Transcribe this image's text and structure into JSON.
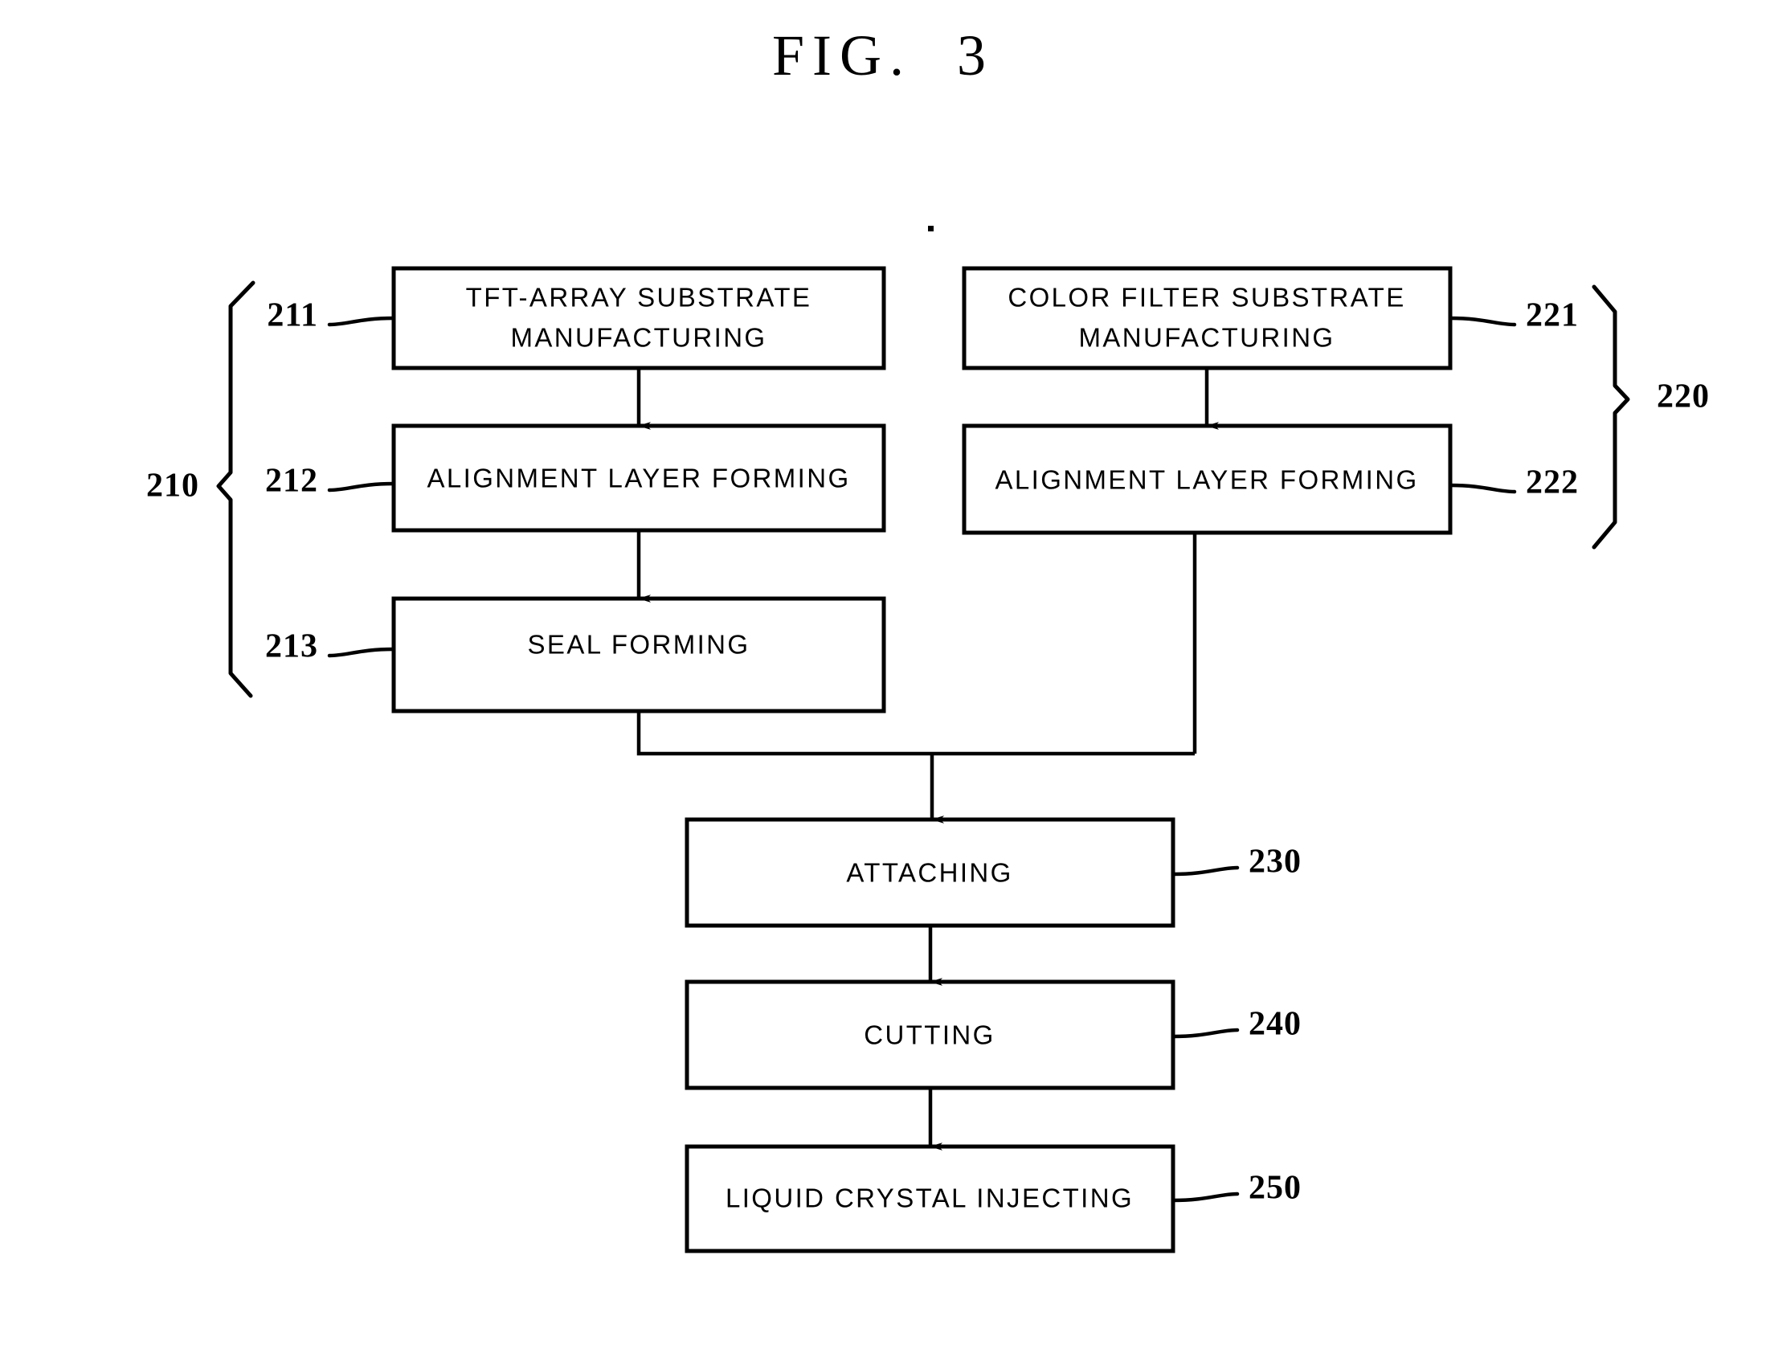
{
  "figure": {
    "title": "FIG.  3",
    "domain_note": "patent flow diagram",
    "stroke_color": "#000000",
    "background_color": "#ffffff"
  },
  "boxes": [
    {
      "id": "211",
      "label_line1": "TFT-ARRAY SUBSTRATE",
      "label_line2": "MANUFACTURING"
    },
    {
      "id": "212",
      "label_line1": "ALIGNMENT LAYER FORMING",
      "label_line2": ""
    },
    {
      "id": "213",
      "label_line1": "SEAL FORMING",
      "label_line2": ""
    },
    {
      "id": "221",
      "label_line1": "COLOR FILTER SUBSTRATE",
      "label_line2": "MANUFACTURING"
    },
    {
      "id": "222",
      "label_line1": "ALIGNMENT LAYER FORMING",
      "label_line2": ""
    },
    {
      "id": "230",
      "label_line1": "ATTACHING",
      "label_line2": ""
    },
    {
      "id": "240",
      "label_line1": "CUTTING",
      "label_line2": ""
    },
    {
      "id": "250",
      "label_line1": "LIQUID CRYSTAL INJECTING",
      "label_line2": ""
    }
  ],
  "reference_numerals": {
    "group_left": "210",
    "group_right": "220",
    "step_211": "211",
    "step_212": "212",
    "step_213": "213",
    "step_221": "221",
    "step_222": "222",
    "step_230": "230",
    "step_240": "240",
    "step_250": "250"
  }
}
